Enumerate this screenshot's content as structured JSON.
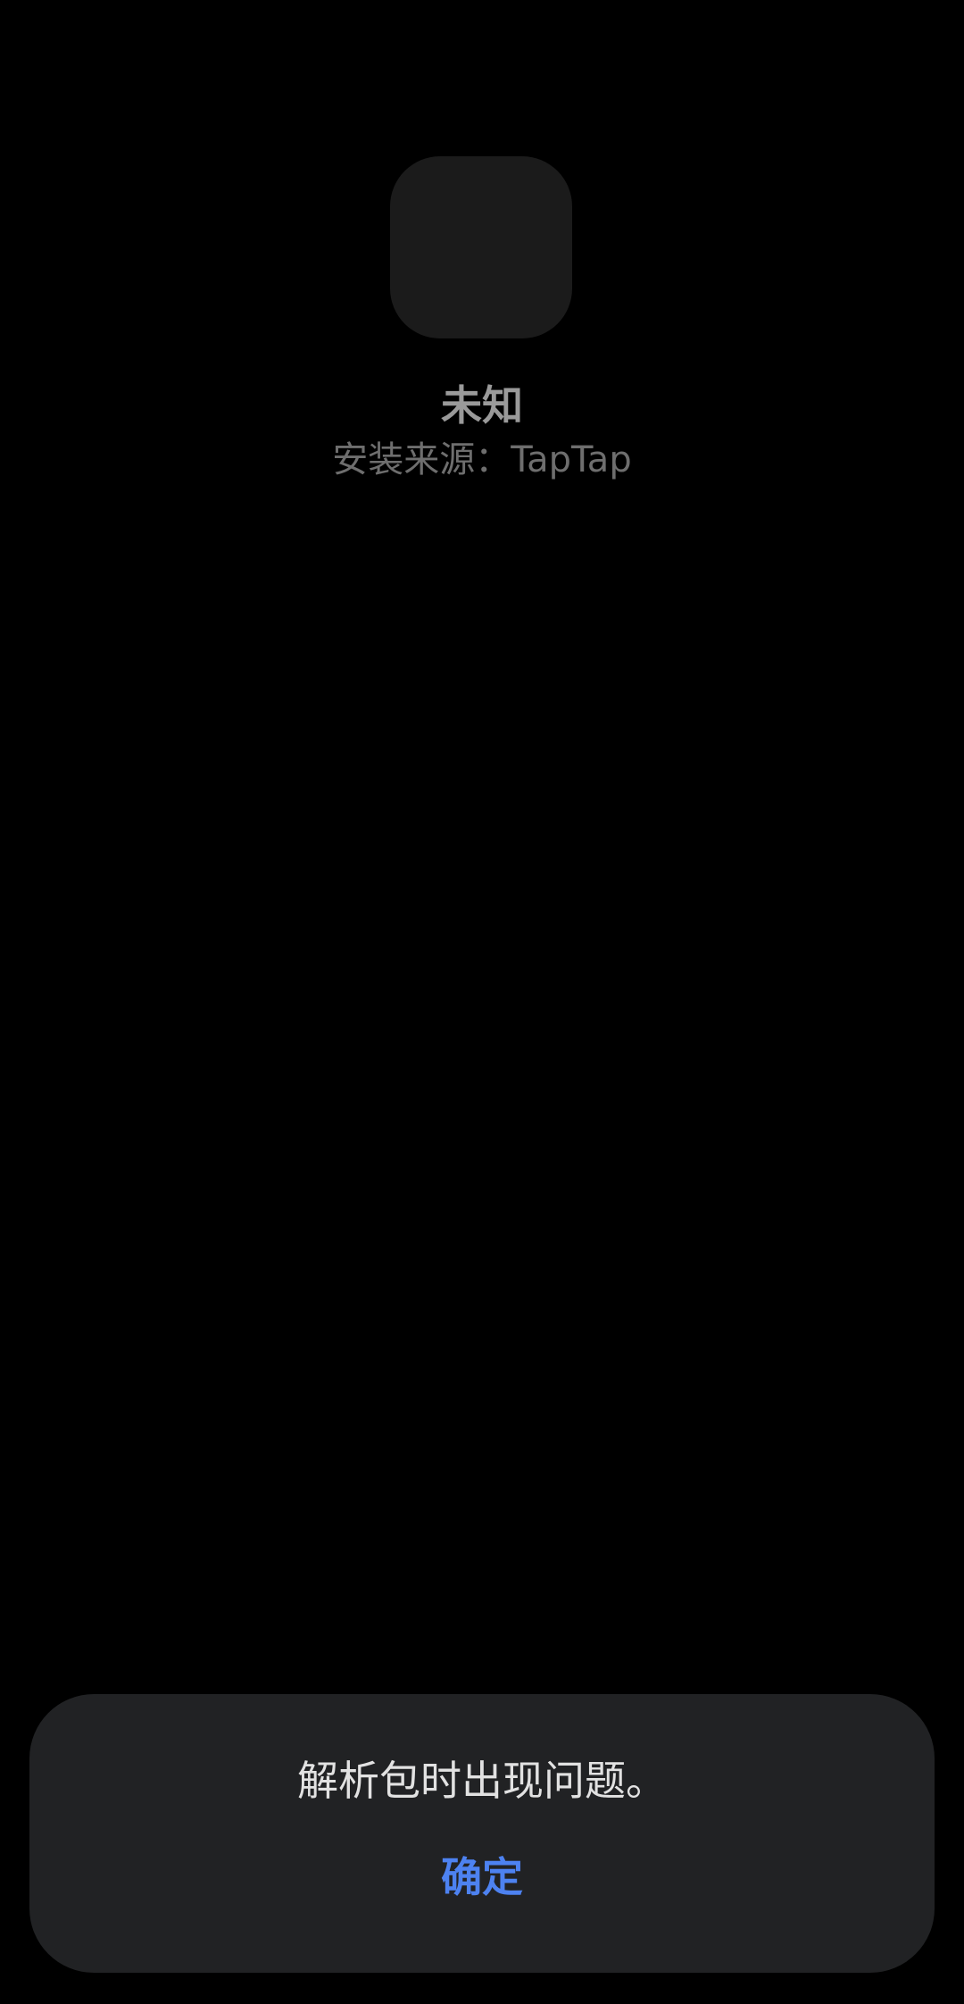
{
  "app": {
    "name": "未知",
    "install_source": "安装来源：TapTap"
  },
  "dialog": {
    "message": "解析包时出现问题。",
    "confirm_label": "确定",
    "confirm_color": "#4d82f1"
  }
}
